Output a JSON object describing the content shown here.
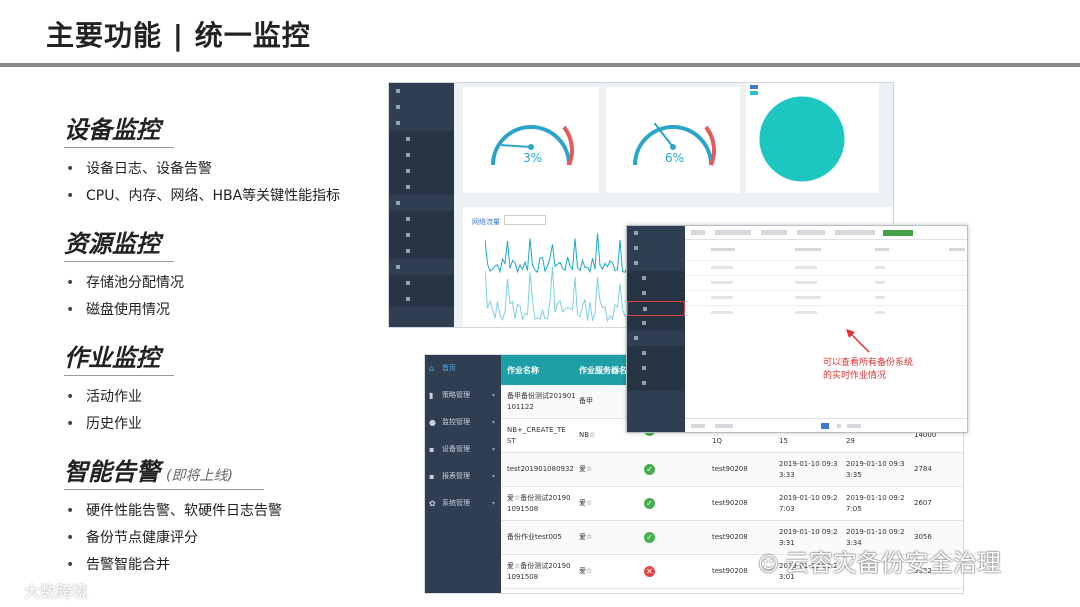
{
  "page": {
    "title": "主要功能 | 统一监控"
  },
  "sections": [
    {
      "title": "设备监控",
      "note": "",
      "bullets": [
        "设备日志、设备告警",
        "CPU、内存、网络、HBA等关键性能指标"
      ]
    },
    {
      "title": "资源监控",
      "note": "",
      "bullets": [
        "存储池分配情况",
        "磁盘使用情况"
      ]
    },
    {
      "title": "作业监控",
      "note": "",
      "bullets": [
        "活动作业",
        "历史作业"
      ]
    },
    {
      "title": "智能告警",
      "note": "(即将上线)",
      "bullets": [
        "硬件性能告警、软硬件日志告警",
        "备份节点健康评分",
        "告警智能合并"
      ]
    }
  ],
  "dashboard": {
    "gauges": [
      {
        "value": 3,
        "label": "3%"
      },
      {
        "value": 6,
        "label": "6%"
      }
    ],
    "network_title": "网络流量",
    "colors": {
      "gauge_low": "#2aa4c8",
      "gauge_high": "#e55a5a",
      "pie": "#1ec6c2",
      "line": "#1aa8c8"
    }
  },
  "jobs_table": {
    "sidebar": [
      "首页",
      "策略管理",
      "监控管理",
      "设备管理",
      "报表管理",
      "系统管理"
    ],
    "headers": [
      "作业名称",
      "作业服务器名称"
    ],
    "rows": [
      {
        "name": "备甲备份测试201901101122",
        "server": "备甲",
        "status": "",
        "host": "",
        "start": "",
        "end": "",
        "size": ""
      },
      {
        "name": "NB+_CREATE_TEST",
        "server": "NB☆",
        "status": "ok",
        "host": "1Q",
        "start": "15",
        "end": "29",
        "size": "14000"
      },
      {
        "name": "test201901080932",
        "server": "爱☆",
        "status": "ok",
        "host": "test90208",
        "start": "2019-01-10 09:33:33",
        "end": "2019-01-10 09:33:35",
        "size": "2784"
      },
      {
        "name": "爱☆备份测试201901091508",
        "server": "爱☆",
        "status": "ok",
        "host": "test90208",
        "start": "2019-01-10 09:27:03",
        "end": "2019-01-10 09:27:05",
        "size": "2607"
      },
      {
        "name": "备份作业test005",
        "server": "爱☆",
        "status": "ok",
        "host": "test90208",
        "start": "2019-01-10 09:23:31",
        "end": "2019-01-10 09:23:34",
        "size": "3056"
      },
      {
        "name": "爱☆备份测试201901091508",
        "server": "爱☆",
        "status": "error",
        "host": "test90208",
        "start": "2019-01-10 09:23:01",
        "end": "",
        "size": "3932"
      }
    ]
  },
  "overlay": {
    "callout": [
      "可以查看所有备份系统",
      "的实时作业情况"
    ]
  },
  "watermarks": {
    "left": "大数跨境",
    "right": "云容灾备份安全治理"
  }
}
